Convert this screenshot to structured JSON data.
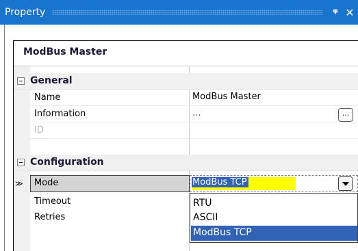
{
  "window": {
    "title": "Property",
    "pin_icon": "pin-icon",
    "close_icon": "close-icon",
    "pin_glyph": "ᵠ",
    "close_glyph": "✕",
    "title_color": "#1874cd"
  },
  "object": {
    "name": "ModBus Master"
  },
  "categories": {
    "general": {
      "label": "General",
      "properties": {
        "name": {
          "label": "Name",
          "value": "ModBus Master"
        },
        "information": {
          "label": "Information",
          "value": "...",
          "button_label": "..."
        },
        "id": {
          "label": "ID",
          "value": ""
        }
      }
    },
    "configuration": {
      "label": "Configuration",
      "properties": {
        "mode": {
          "label": "Mode",
          "value": "ModBus TCP",
          "selected_indicator": "≫"
        },
        "timeout": {
          "label": "Timeout"
        },
        "retries": {
          "label": "Retries"
        }
      }
    }
  },
  "mode_dropdown": {
    "options": [
      "RTU",
      "ASCII",
      "ModBus TCP"
    ],
    "selected": "ModBus TCP",
    "highlight_color": "#3162b4",
    "value_highlight_color": "#ffff00"
  }
}
